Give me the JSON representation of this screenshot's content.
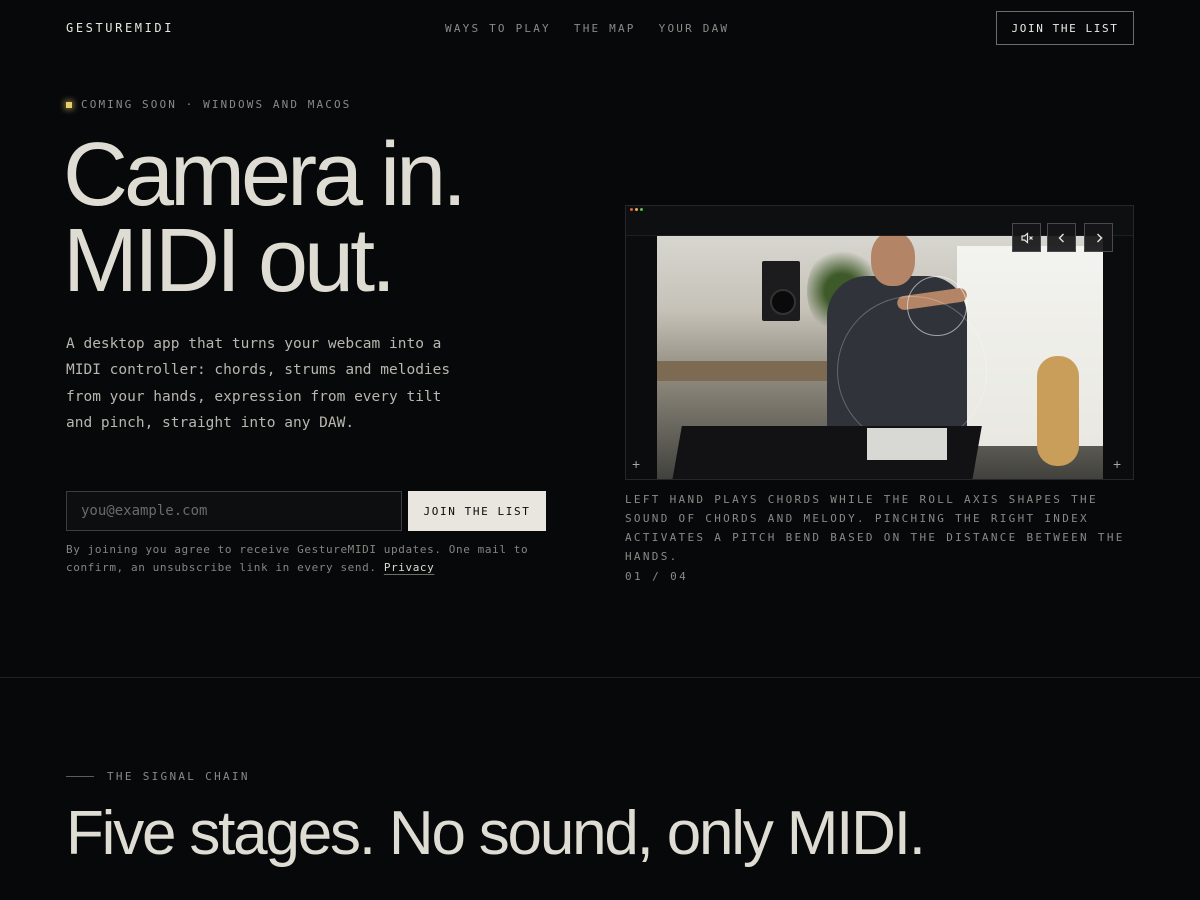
{
  "header": {
    "brand": "GESTUREMIDI",
    "nav": [
      "WAYS TO PLAY",
      "THE MAP",
      "YOUR DAW"
    ],
    "cta_label": "JOIN THE LIST"
  },
  "hero": {
    "eyebrow": "COMING SOON · WINDOWS AND MACOS",
    "headline_line1": "Camera in.",
    "headline_line2": "MIDI out.",
    "lede": "A desktop app that turns your webcam into a MIDI controller: chords, strums and melodies from your hands, expression from every tilt and pinch, straight into any DAW.",
    "email_placeholder": "you@example.com",
    "submit_label": "JOIN THE LIST",
    "legal_text": "By joining you agree to receive GestureMIDI updates. One mail to confirm, an unsubscribe link in every send.",
    "privacy_link": "Privacy"
  },
  "media": {
    "controls": [
      "mute-icon",
      "chevron-left-icon",
      "chevron-right-icon"
    ],
    "caption": "LEFT HAND PLAYS CHORDS WHILE THE ROLL AXIS SHAPES THE SOUND OF CHORDS AND MELODY. PINCHING THE RIGHT INDEX ACTIVATES A PITCH BEND BASED ON THE DISTANCE BETWEEN THE HANDS.",
    "counter": "01 / 04"
  },
  "signal_chain": {
    "label": "THE SIGNAL CHAIN",
    "title": "Five stages. No sound, only MIDI."
  },
  "colors": {
    "background": "#07080a",
    "text": "#dedcd3",
    "muted": "#8a8a86",
    "accent_dot": "#e6cf6a",
    "button_light": "#e8e6df"
  }
}
